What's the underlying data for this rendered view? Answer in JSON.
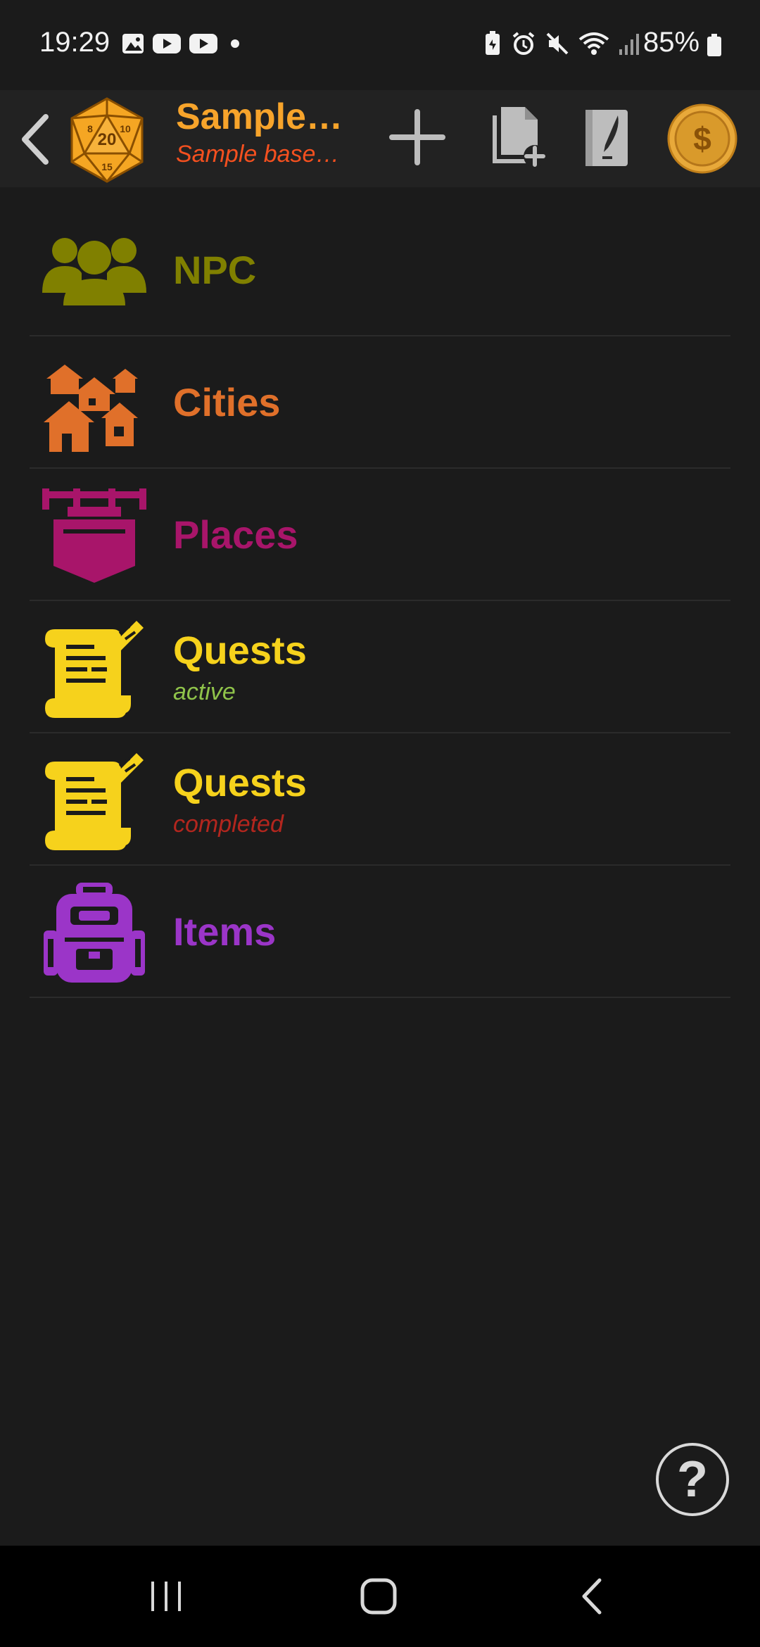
{
  "status_bar": {
    "time": "19:29",
    "battery": "85%",
    "left_icons": [
      "image-icon",
      "youtube-icon",
      "youtube-icon",
      "dot-icon"
    ],
    "right_icons": [
      "battery-saver-icon",
      "alarm-icon",
      "mute-icon",
      "wifi-icon",
      "signal-icon",
      "battery-icon"
    ]
  },
  "app_bar": {
    "title": "Sample…",
    "subtitle": "Sample base…",
    "logo": "d20-dice-icon",
    "actions": [
      "plus-icon",
      "copy-add-icon",
      "journal-quill-icon",
      "coin-dollar-icon"
    ],
    "colors": {
      "title": "#f7a42b",
      "subtitle": "#f4501f"
    }
  },
  "categories": [
    {
      "label": "NPC",
      "sub": "",
      "icon": "people-group-icon",
      "color": "#808000",
      "sub_color": ""
    },
    {
      "label": "Cities",
      "sub": "",
      "icon": "houses-icon",
      "color": "#e0702a",
      "sub_color": ""
    },
    {
      "label": "Places",
      "sub": "",
      "icon": "hanging-sign-icon",
      "color": "#a8156a",
      "sub_color": ""
    },
    {
      "label": "Quests",
      "sub": "active",
      "icon": "scroll-quill-icon",
      "color": "#f6d21c",
      "sub_color": "#8fc34a"
    },
    {
      "label": "Quests",
      "sub": "completed",
      "icon": "scroll-quill-icon",
      "color": "#f6d21c",
      "sub_color": "#b3261e"
    },
    {
      "label": "Items",
      "sub": "",
      "icon": "backpack-icon",
      "color": "#9b35c8",
      "sub_color": ""
    }
  ],
  "help": {
    "label": "?"
  },
  "nav": [
    "recents-icon",
    "home-icon",
    "back-icon"
  ]
}
